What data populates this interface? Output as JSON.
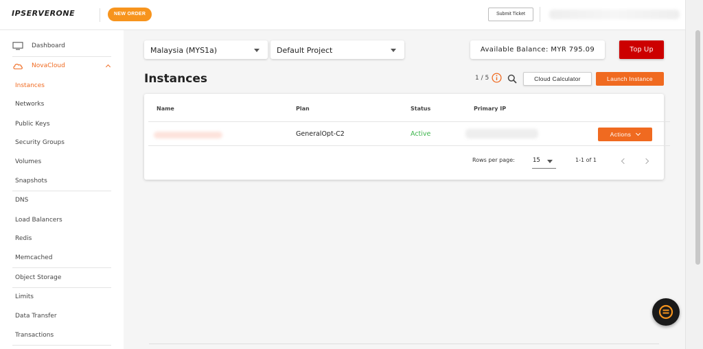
{
  "header": {
    "logo_text": "IPSERVERONE",
    "new_order_label": "NEW ORDER",
    "submit_ticket_label": "Submit Ticket"
  },
  "sidebar": {
    "items": [
      {
        "label": "Dashboard",
        "icon": "monitor-icon"
      },
      {
        "label": "NovaCloud",
        "icon": "cloud-icon",
        "expanded": true
      },
      {
        "label": "Instances",
        "active": true
      },
      {
        "label": "Networks"
      },
      {
        "label": "Public Keys"
      },
      {
        "label": "Security Groups"
      },
      {
        "label": "Volumes"
      },
      {
        "label": "Snapshots"
      },
      {
        "label": "DNS"
      },
      {
        "label": "Load Balancers"
      },
      {
        "label": "Redis"
      },
      {
        "label": "Memcached"
      },
      {
        "label": "Object Storage"
      },
      {
        "label": "Limits"
      },
      {
        "label": "Data Transfer"
      },
      {
        "label": "Transactions"
      }
    ]
  },
  "toolbar": {
    "region_value": "Malaysia (MYS1a)",
    "project_value": "Default Project",
    "balance_text": "Available Balance: MYR 795.09",
    "topup_label": "Top Up"
  },
  "instances": {
    "title": "Instances",
    "count": "1 / 5",
    "cloud_calc_label": "Cloud Calculator",
    "launch_label": "Launch Instance",
    "columns": [
      "Name",
      "Plan",
      "Status",
      "Primary IP"
    ],
    "rows": [
      {
        "plan": "GeneralOpt-C2",
        "status": "Active",
        "actions_label": "Actions"
      }
    ],
    "rows_per_page_label": "Rows per page:",
    "rows_per_page_value": "15",
    "range_text": "1-1 of 1"
  },
  "colors": {
    "accent": "#f06a20",
    "topup": "#cc0000",
    "new_order": "#f7941d",
    "active_status": "#3cb44b"
  }
}
